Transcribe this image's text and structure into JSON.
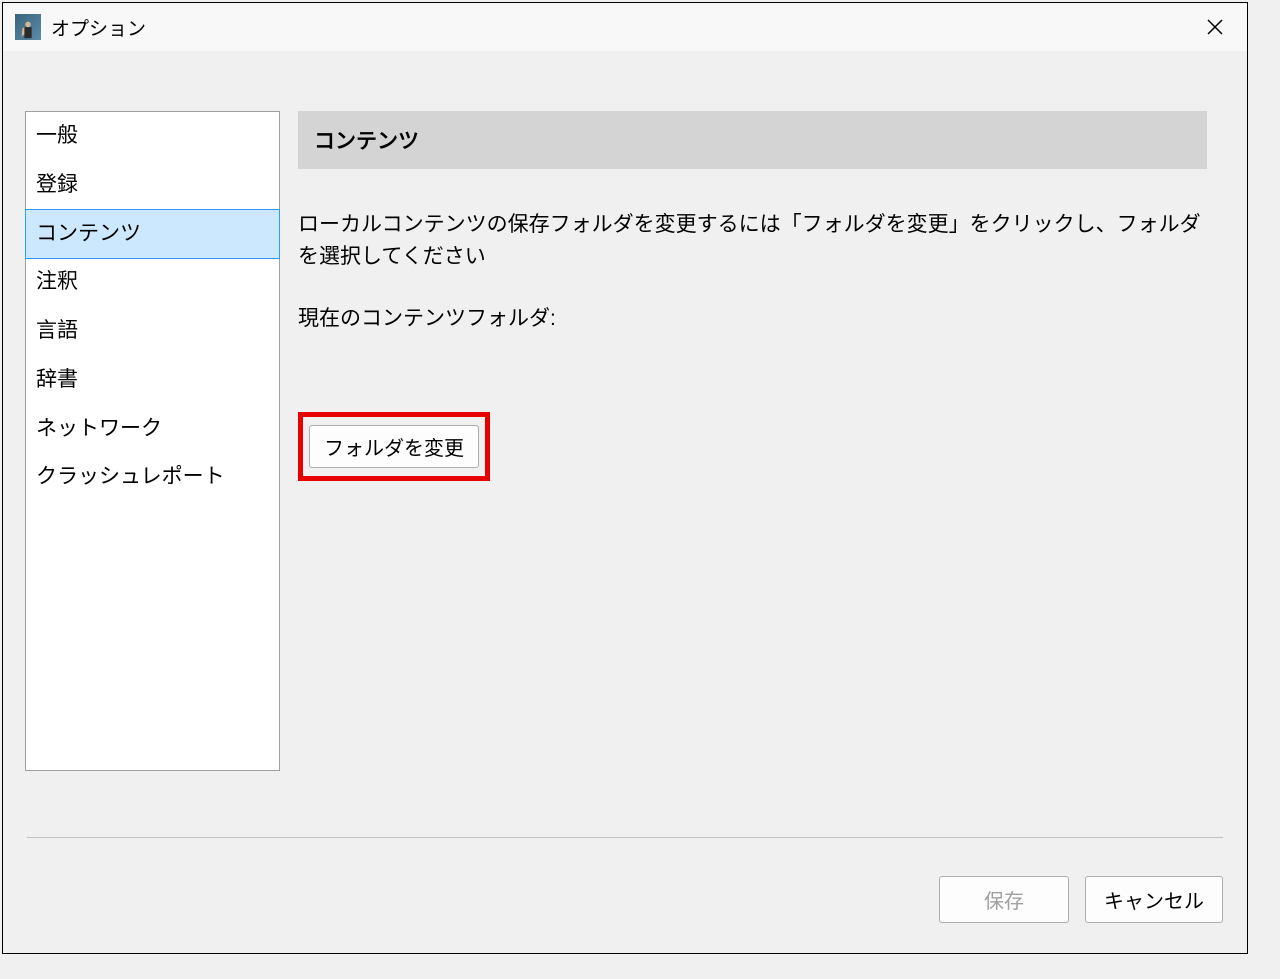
{
  "window": {
    "title": "オプション"
  },
  "sidebar": {
    "items": [
      {
        "label": "一般",
        "selected": false
      },
      {
        "label": "登録",
        "selected": false
      },
      {
        "label": "コンテンツ",
        "selected": true
      },
      {
        "label": "注釈",
        "selected": false
      },
      {
        "label": "言語",
        "selected": false
      },
      {
        "label": "辞書",
        "selected": false
      },
      {
        "label": "ネットワーク",
        "selected": false
      },
      {
        "label": "クラッシュレポート",
        "selected": false
      }
    ]
  },
  "main": {
    "section_title": "コンテンツ",
    "description": "ローカルコンテンツの保存フォルダを変更するには「フォルダを変更」をクリックし、フォルダを選択してください",
    "current_folder_label": "現在のコンテンツフォルダ:",
    "change_folder_button": "フォルダを変更"
  },
  "footer": {
    "save_label": "保存",
    "cancel_label": "キャンセル",
    "save_enabled": false
  },
  "highlight": {
    "color": "#e60000"
  }
}
